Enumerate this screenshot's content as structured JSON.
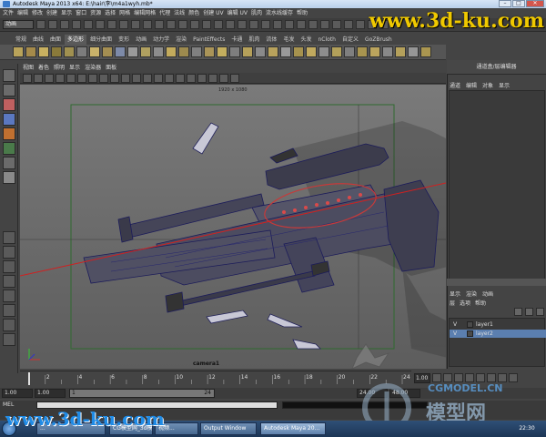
{
  "window": {
    "title": "Autodesk Maya 2013 x64: E:\\hair\\李\\m4a1wyh.mb*"
  },
  "menubar": [
    "文件",
    "编辑",
    "修改",
    "创建",
    "显示",
    "窗口",
    "资源",
    "选择",
    "网格",
    "编辑网格",
    "代理",
    "法线",
    "颜色",
    "创建 UV",
    "编辑 UV",
    "肌肉",
    "流水线缓存",
    "帮助"
  ],
  "status_line": {
    "mode": "动画"
  },
  "watermark": {
    "top": "www.3d-ku.com",
    "bottom": "www.3d-ku.com",
    "cg_text": "CGMODEL.CN",
    "cg_cn": "模型网"
  },
  "shelf_tabs": [
    "常规",
    "曲线",
    "曲面",
    "多边形",
    "细分曲面",
    "变形",
    "动画",
    "动力学",
    "渲染",
    "PaintEffects",
    "卡通",
    "肌肉",
    "流体",
    "毛发",
    "头发",
    "nCloth",
    "自定义",
    "GoZBrush"
  ],
  "shelf_active_index": 3,
  "panel_menu": [
    "视图",
    "着色",
    "照明",
    "显示",
    "渲染器",
    "面板"
  ],
  "viewport": {
    "camera_label": "camera1",
    "frame_label": "1920 x 1080"
  },
  "right_panel": {
    "header": "通道盒/层编辑器",
    "tabs": [
      "通道",
      "编辑",
      "对象",
      "显示"
    ],
    "layer_tabs": [
      "显示",
      "渲染",
      "动画"
    ],
    "layer_menu": [
      "层",
      "选项",
      "帮助"
    ],
    "layers": [
      {
        "vis": "V",
        "name": "layer1",
        "color": "#4a4a4a",
        "selected": false
      },
      {
        "vis": "V",
        "name": "layer2",
        "color": "#4a4a4a",
        "selected": true
      }
    ]
  },
  "timeline": {
    "ticks": [
      "2",
      "4",
      "6",
      "8",
      "10",
      "12",
      "14",
      "16",
      "18",
      "20",
      "22",
      "24"
    ],
    "current_frame": "1.00"
  },
  "range": {
    "start": "1.00",
    "inner_start": "1.00",
    "slider_start": "1",
    "slider_end": "24",
    "end": "24.00",
    "anim_end": "48.00"
  },
  "cmd": {
    "label": "MEL"
  },
  "taskbar": [
    {
      "label": "...",
      "active": false
    },
    {
      "label": "CG模型网_3d模型...",
      "active": false
    },
    {
      "label": "视频...",
      "active": false
    },
    {
      "label": "Output Window",
      "active": false
    },
    {
      "label": "Autodesk Maya 20...",
      "active": true
    }
  ],
  "clock": "22:30",
  "icons": {
    "app": "maya-icon",
    "start": "windows-start-icon"
  }
}
